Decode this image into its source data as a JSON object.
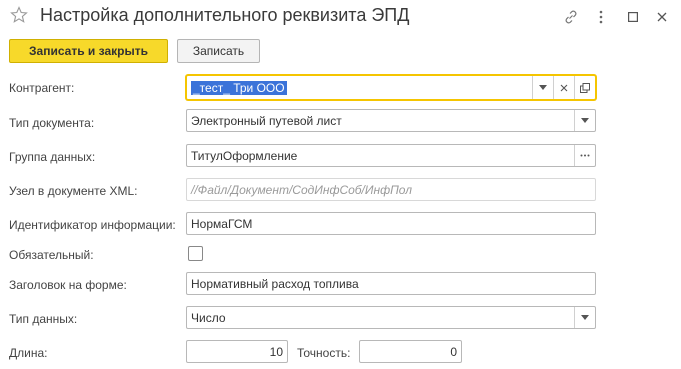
{
  "window": {
    "title": "Настройка дополнительного реквизита ЭПД",
    "icons": [
      "star-icon",
      "link-icon",
      "more-icon",
      "maximize-icon",
      "close-icon"
    ]
  },
  "toolbar": {
    "save_close_label": "Записать и закрыть",
    "save_label": "Записать"
  },
  "form": {
    "counterparty": {
      "label": "Контрагент:",
      "value": "_тест_ Три ООО"
    },
    "doc_type": {
      "label": "Тип документа:",
      "value": "Электронный путевой лист"
    },
    "data_group": {
      "label": "Группа данных:",
      "value": "ТитулОформление"
    },
    "xml_node": {
      "label": "Узел в документе XML:",
      "value": "//Файл/Документ/СодИнфСоб/ИнфПол"
    },
    "info_id": {
      "label": "Идентификатор информации:",
      "value": "НормаГСМ"
    },
    "required": {
      "label": "Обязательный:",
      "checked": false
    },
    "form_title": {
      "label": "Заголовок на форме:",
      "value": "Нормативный расход топлива"
    },
    "data_type": {
      "label": "Тип данных:",
      "value": "Число"
    },
    "length": {
      "label": "Длина:",
      "value": "10"
    },
    "precision": {
      "label": "Точность:",
      "value": "0"
    }
  },
  "colors": {
    "primary_button": "#f7d92a",
    "active_border": "#f5c500",
    "selection": "#3b73d9"
  }
}
